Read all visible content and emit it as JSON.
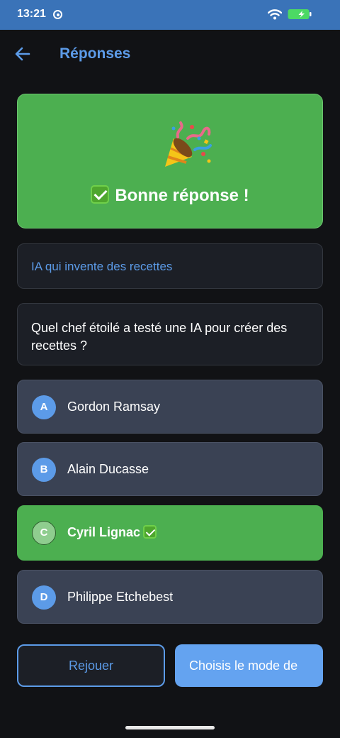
{
  "status_bar": {
    "time": "13:21"
  },
  "header": {
    "title": "Réponses"
  },
  "result": {
    "message": "Bonne réponse !"
  },
  "topic": "IA qui invente des recettes",
  "question": "Quel chef étoilé a testé une IA pour créer des recettes ?",
  "options": [
    {
      "letter": "A",
      "text": "Gordon Ramsay"
    },
    {
      "letter": "B",
      "text": "Alain Ducasse"
    },
    {
      "letter": "C",
      "text": "Cyril Lignac",
      "correct": true
    },
    {
      "letter": "D",
      "text": "Philippe Etchebest"
    }
  ],
  "buttons": {
    "replay": "Rejouer",
    "mode": "Choisis le mode de"
  },
  "colors": {
    "accent": "#5c9be8",
    "success": "#4caf50",
    "card": "#3a4254",
    "background": "#111215",
    "status_bar": "#3a73b8"
  }
}
